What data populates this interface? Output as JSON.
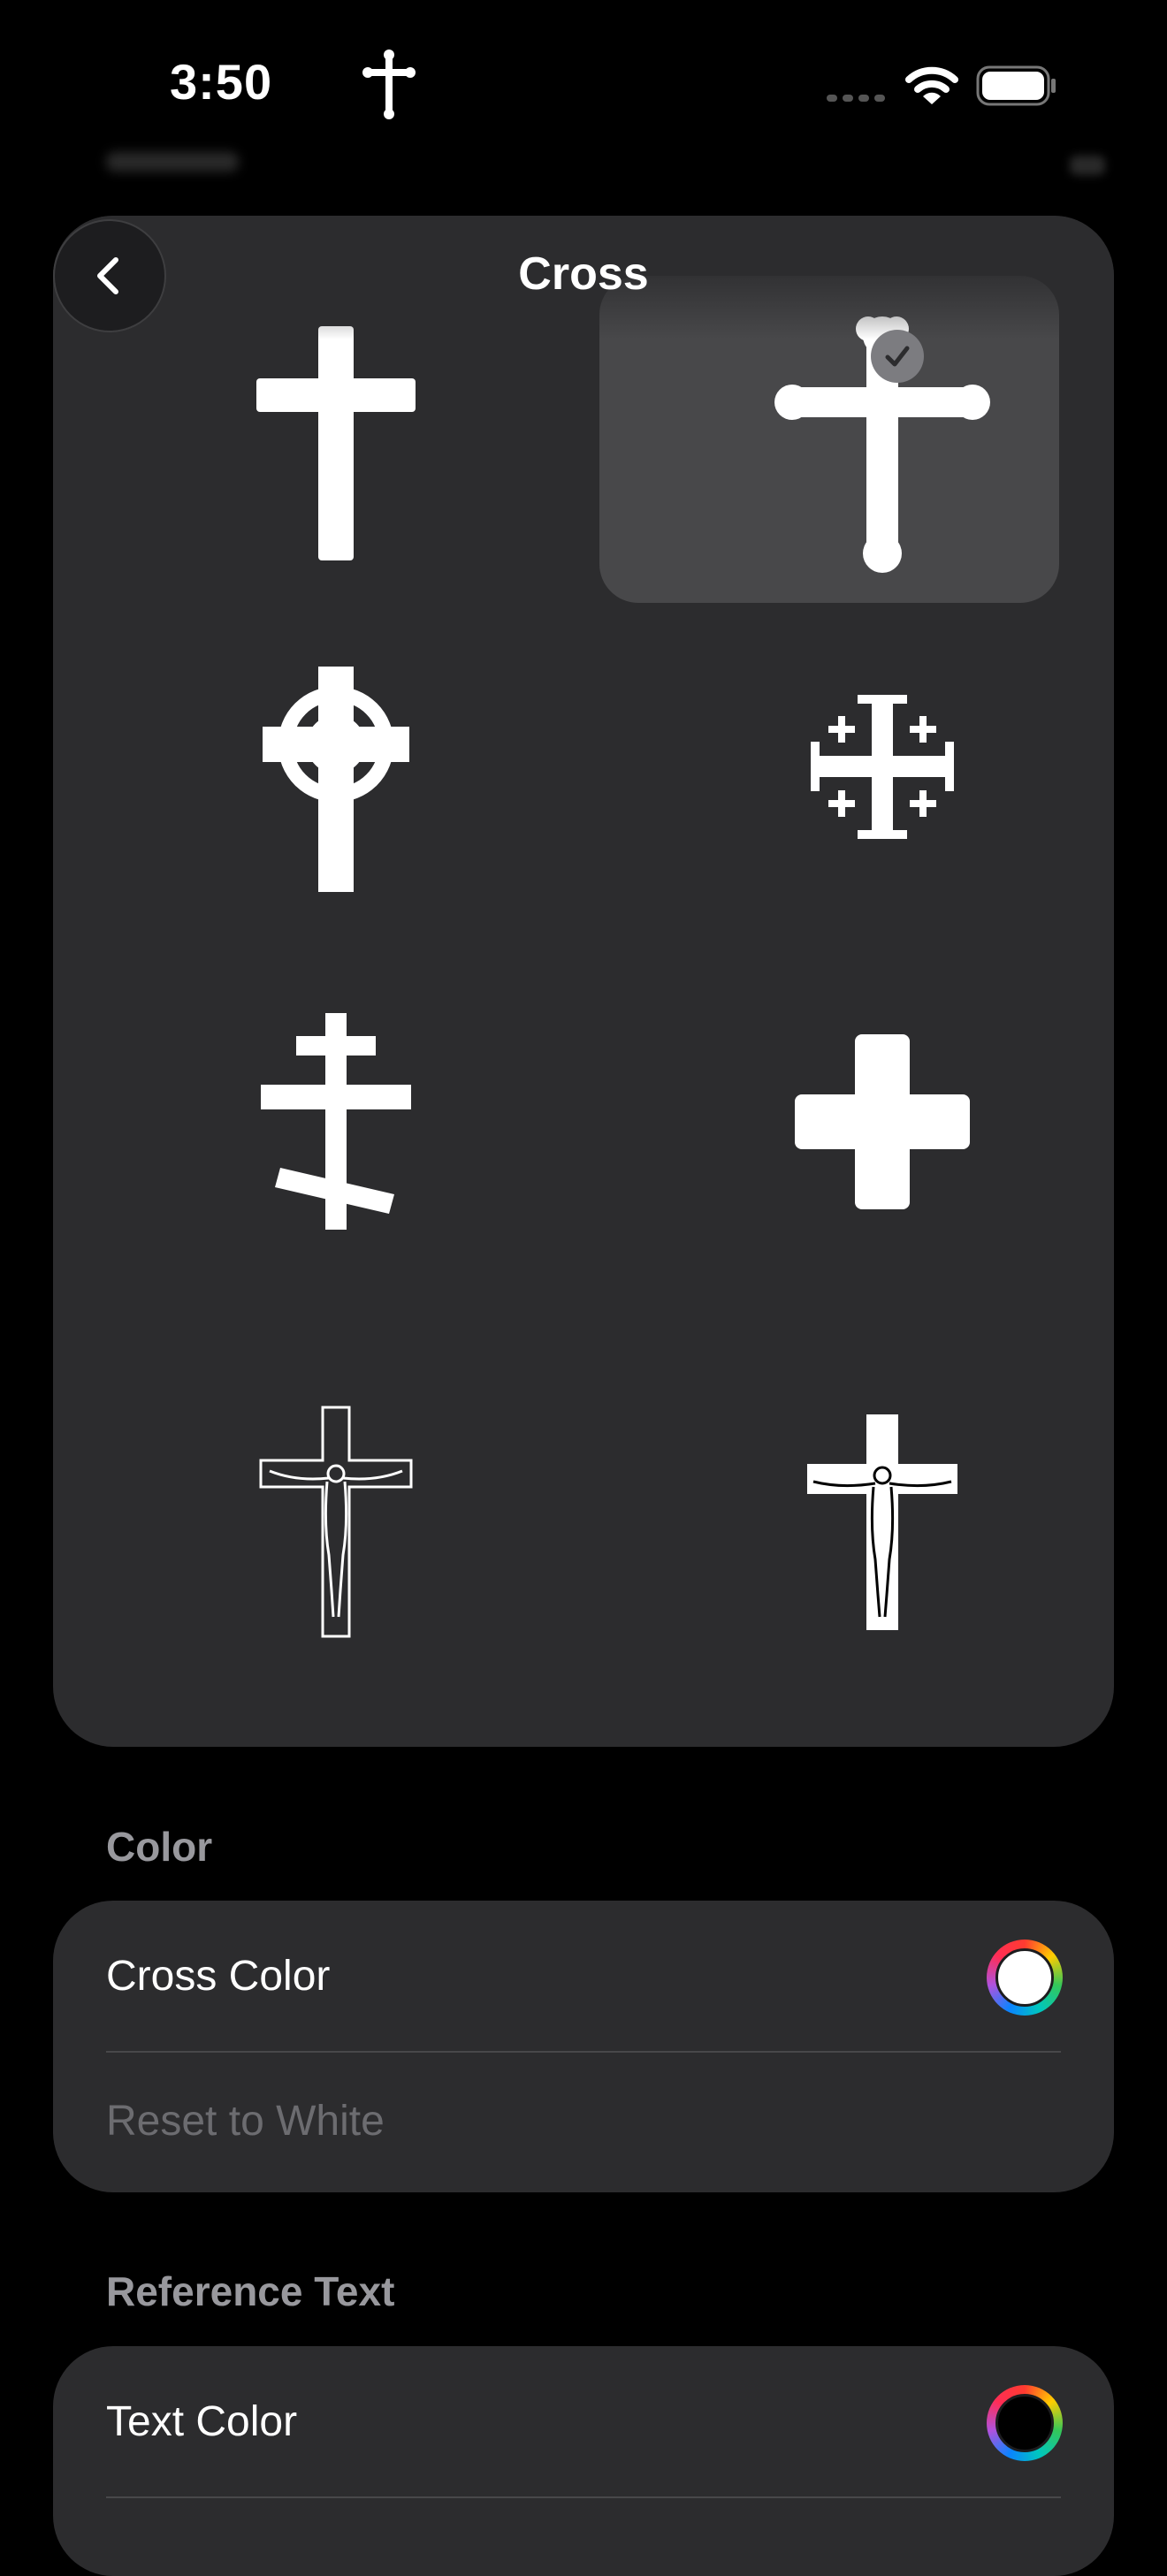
{
  "status_bar": {
    "time": "3:50"
  },
  "nav": {
    "title": "Cross"
  },
  "cross_options": [
    {
      "name": "Latin",
      "selected": false
    },
    {
      "name": "Budded",
      "selected": true
    },
    {
      "name": "Celtic",
      "selected": false
    },
    {
      "name": "Jerusalem",
      "selected": false
    },
    {
      "name": "Orthodox",
      "selected": false
    },
    {
      "name": "Greek",
      "selected": false
    },
    {
      "name": "Crucifix Outline",
      "selected": false
    },
    {
      "name": "Crucifix",
      "selected": false
    }
  ],
  "color_section": {
    "header": "Color",
    "cross_color_label": "Cross Color",
    "cross_color_value": "#ffffff",
    "reset_label": "Reset to White"
  },
  "reference_section": {
    "header": "Reference Text",
    "text_color_label": "Text Color",
    "text_color_value": "#000000"
  },
  "colors": {
    "background": "#000000",
    "card": "#2c2c2e",
    "selected_cell": "#48484a",
    "secondary_text": "#98989d"
  }
}
